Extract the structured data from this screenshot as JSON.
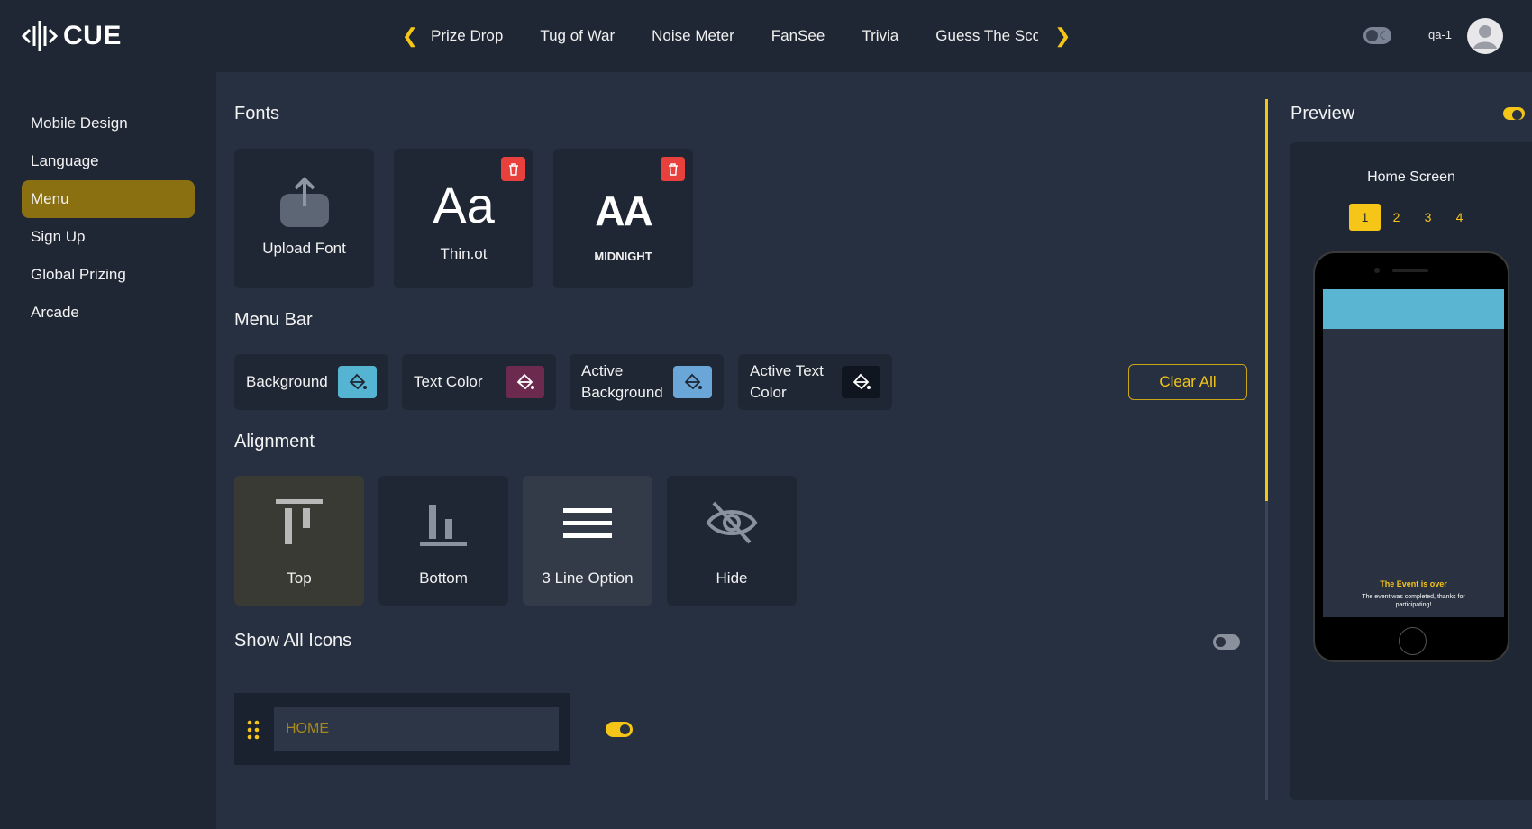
{
  "brand": {
    "name": "CUE"
  },
  "topnav": {
    "tabs": [
      "Prize Drop",
      "Tug of War",
      "Noise Meter",
      "FanSee",
      "Trivia",
      "Guess The Sco"
    ],
    "prev_icon": "chevron-left-icon",
    "next_icon": "chevron-right-icon"
  },
  "user": {
    "name": "qa-1",
    "avatar_icon": "user-icon",
    "theme_toggle_icon": "moon-icon"
  },
  "sidebar": {
    "items": [
      {
        "label": "Mobile Design",
        "active": false
      },
      {
        "label": "Language",
        "active": false
      },
      {
        "label": "Menu",
        "active": true
      },
      {
        "label": "Sign Up",
        "active": false
      },
      {
        "label": "Global Prizing",
        "active": false
      },
      {
        "label": "Arcade",
        "active": false
      }
    ]
  },
  "fonts": {
    "title": "Fonts",
    "upload_label": "Upload Font",
    "items": [
      {
        "preview": "Aa",
        "name": "Thin.ot"
      },
      {
        "preview": "AA",
        "name": "MIDNIGHT"
      }
    ]
  },
  "menu_bar": {
    "title": "Menu Bar",
    "colors": [
      {
        "label": "Background",
        "color": "#56b4d3"
      },
      {
        "label": "Text Color",
        "color": "#6b2a4e"
      },
      {
        "label": "Active Background",
        "color": "#6aa6d8"
      },
      {
        "label": "Active Text Color",
        "color": "#0f1620"
      }
    ],
    "clear_all": "Clear All"
  },
  "alignment": {
    "title": "Alignment",
    "options": [
      {
        "label": "Top",
        "icon": "align-top-icon",
        "selected": true
      },
      {
        "label": "Bottom",
        "icon": "align-bottom-icon",
        "selected": false
      },
      {
        "label": "3 Line Option",
        "icon": "hamburger-icon",
        "selected": false
      },
      {
        "label": "Hide",
        "icon": "eye-off-icon",
        "selected": false
      }
    ]
  },
  "show_all_icons": {
    "title": "Show All Icons",
    "enabled": false
  },
  "menu_items": [
    {
      "label": "HOME",
      "enabled": true
    }
  ],
  "preview": {
    "title": "Preview",
    "enabled": true,
    "screen_title": "Home Screen",
    "pages": [
      "1",
      "2",
      "3",
      "4"
    ],
    "active_page": "1",
    "event_title": "The Event is over",
    "event_message": "The event was completed, thanks for participating!"
  },
  "colors": {
    "accent": "#f5c518",
    "sidebar_active": "#8b7012",
    "trash": "#e8403c"
  }
}
